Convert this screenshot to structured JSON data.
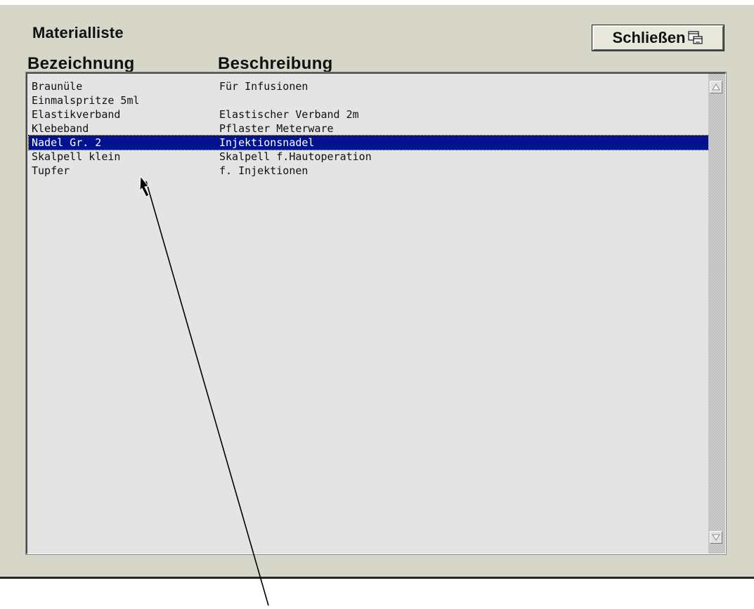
{
  "window": {
    "title": "Materialliste",
    "close_button_label": "Schließen",
    "close_icon": "window-close-icon"
  },
  "columns": {
    "bezeichnung": "Bezeichnung",
    "beschreibung": "Beschreibung"
  },
  "list": {
    "selected_index": 4,
    "rows": [
      {
        "bezeichnung": "Braunüle",
        "beschreibung": "Für Infusionen"
      },
      {
        "bezeichnung": "Einmalspritze 5ml",
        "beschreibung": ""
      },
      {
        "bezeichnung": "Elastikverband",
        "beschreibung": "Elastischer Verband 2m"
      },
      {
        "bezeichnung": "Klebeband",
        "beschreibung": "Pflaster Meterware"
      },
      {
        "bezeichnung": "Nadel Gr. 2",
        "beschreibung": "Injektionsnadel"
      },
      {
        "bezeichnung": "Skalpell klein",
        "beschreibung": "Skalpell f.Hautoperation"
      },
      {
        "bezeichnung": "Tupfer",
        "beschreibung": "f. Injektionen"
      }
    ]
  },
  "scrollbar": {
    "up_icon": "scroll-up-arrow-icon",
    "down_icon": "scroll-down-arrow-icon"
  },
  "colors": {
    "panel_bg": "#d7d7c9",
    "list_bg": "#e4e4e4",
    "selection": "#00128f"
  }
}
